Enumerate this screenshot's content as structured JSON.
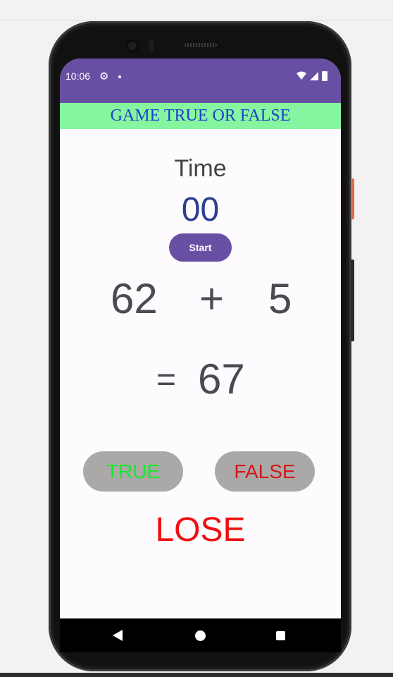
{
  "status_bar": {
    "time": "10:06",
    "icons": [
      "gear-icon",
      "notification-dot-icon",
      "wifi-icon",
      "signal-icon",
      "battery-icon"
    ]
  },
  "app": {
    "title": "GAME TRUE OR FALSE"
  },
  "timer": {
    "label": "Time",
    "value": "00",
    "start_label": "Start"
  },
  "equation": {
    "operand_a": "62",
    "operator": "+",
    "operand_b": "5",
    "equals": "=",
    "result": "67"
  },
  "answers": {
    "true_label": "TRUE",
    "false_label": "FALSE"
  },
  "outcome": "LOSE",
  "colors": {
    "accent": "#6750a4",
    "title_bg": "#86f59f",
    "title_text": "#1f3fd0",
    "timer_value": "#2a3f8f",
    "true_text": "#17e82d",
    "false_text": "#d01a1a",
    "outcome_text": "#ee0f0f",
    "answer_button_bg": "#aba8a8"
  },
  "nav_bar": {
    "icons": [
      "back-icon",
      "home-icon",
      "recents-icon"
    ]
  }
}
